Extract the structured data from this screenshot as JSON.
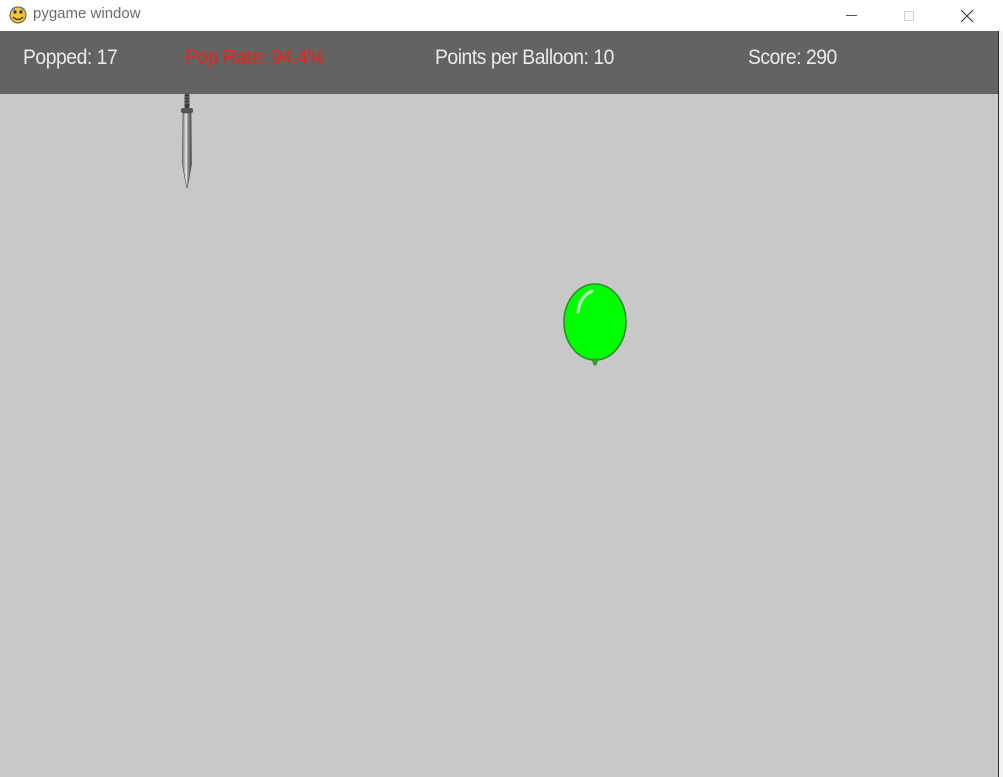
{
  "window": {
    "title": "pygame window",
    "icon": "pygame-snake-icon",
    "controls": {
      "minimize_icon": "minimize-icon",
      "maximize_icon": "maximize-icon",
      "close_icon": "close-icon"
    }
  },
  "hud": {
    "popped": "Popped: 17",
    "pop_rate": "Pop Rate: 94.4%",
    "points_per_balloon": "Points per Balloon: 10",
    "score": "Score: 290"
  },
  "game": {
    "background_color": "#c8c8c8",
    "hud_color": "#636363",
    "pop_rate_color": "#e8241c",
    "sprites": {
      "weapon": "knife-icon",
      "balloon": "balloon-icon",
      "balloon_color": "#00ff00"
    }
  }
}
